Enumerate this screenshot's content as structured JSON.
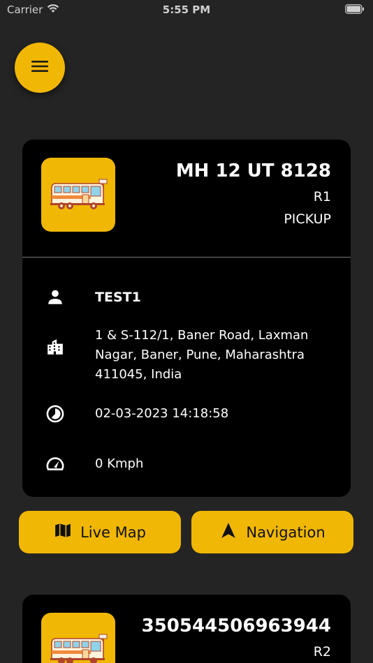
{
  "status_bar": {
    "carrier": "Carrier",
    "time": "5:55 PM"
  },
  "colors": {
    "accent": "#f1b705",
    "background": "#242424",
    "card": "#000000"
  },
  "vehicles": [
    {
      "plate": "MH 12 UT 8128",
      "route": "R1",
      "trip_type": "PICKUP",
      "driver": "TEST1",
      "address": "1 & S-112/1, Baner Road, Laxman Nagar, Baner, Pune, Maharashtra 411045, India",
      "timestamp": "02-03-2023 14:18:58",
      "speed": "0 Kmph",
      "icons": {
        "driver": "person-icon",
        "address": "building-icon",
        "timestamp": "clock-icon",
        "speed": "speedometer-icon"
      }
    },
    {
      "plate": "350544506963944",
      "route": "R2"
    }
  ],
  "actions": {
    "live_map": "Live Map",
    "navigation": "Navigation"
  }
}
